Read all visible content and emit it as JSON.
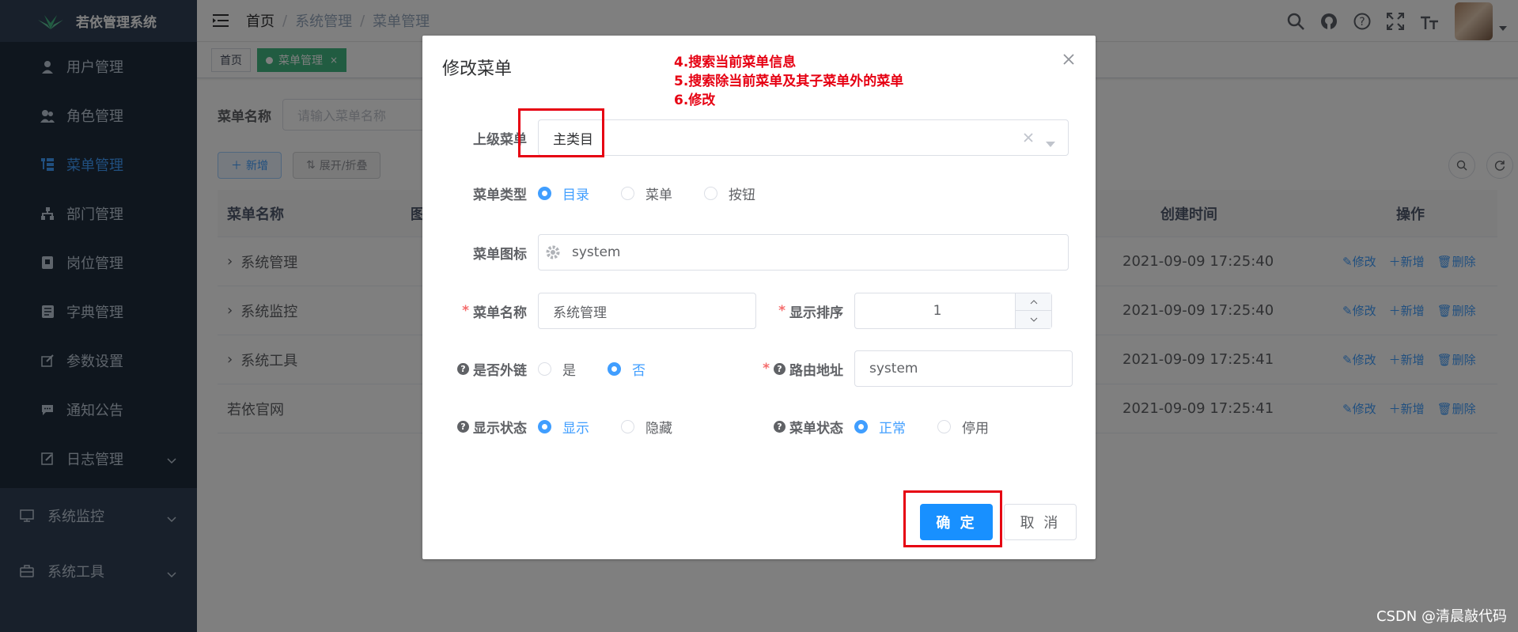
{
  "app": {
    "title": "若依管理系统"
  },
  "sidebar": {
    "items": [
      {
        "label": "用户管理",
        "icon": "user-icon"
      },
      {
        "label": "角色管理",
        "icon": "peoples-icon"
      },
      {
        "label": "菜单管理",
        "icon": "tree-table-icon",
        "active": true
      },
      {
        "label": "部门管理",
        "icon": "tree-icon"
      },
      {
        "label": "岗位管理",
        "icon": "post-icon"
      },
      {
        "label": "字典管理",
        "icon": "dict-icon"
      },
      {
        "label": "参数设置",
        "icon": "edit-icon"
      },
      {
        "label": "通知公告",
        "icon": "message-icon"
      },
      {
        "label": "日志管理",
        "icon": "log-icon"
      }
    ],
    "top_items": [
      {
        "label": "系统监控",
        "icon": "monitor-icon"
      },
      {
        "label": "系统工具",
        "icon": "tool-icon"
      }
    ]
  },
  "breadcrumb": {
    "home": "首页",
    "section": "系统管理",
    "current": "菜单管理",
    "separator": "/"
  },
  "tags": {
    "home": "首页",
    "active": "菜单管理",
    "close": "×"
  },
  "search": {
    "label": "菜单名称",
    "placeholder": "请输入菜单名称"
  },
  "toolbar": {
    "add": "新增",
    "expand": "展开/折叠"
  },
  "table": {
    "headers": {
      "name": "菜单名称",
      "icon": "图",
      "created": "创建时间",
      "ops": "操作"
    },
    "rows": [
      {
        "name": "系统管理",
        "created": "2021-09-09 17:25:40"
      },
      {
        "name": "系统监控",
        "created": "2021-09-09 17:25:40"
      },
      {
        "name": "系统工具",
        "created": "2021-09-09 17:25:41"
      },
      {
        "name": "若依官网",
        "created": "2021-09-09 17:25:41"
      }
    ],
    "ops": {
      "edit": "修改",
      "add": "新增",
      "delete": "删除"
    }
  },
  "dialog": {
    "title": "修改菜单",
    "notes": [
      "4.搜索当前菜单信息",
      "5.搜索除当前菜单及其子菜单外的菜单",
      "6.修改"
    ],
    "parent": {
      "label": "上级菜单",
      "value": "主类目"
    },
    "type": {
      "label": "菜单类型",
      "options": [
        "目录",
        "菜单",
        "按钮"
      ],
      "selected": 0
    },
    "icon": {
      "label": "菜单图标",
      "value": "system"
    },
    "name": {
      "label": "菜单名称",
      "value": "系统管理"
    },
    "order": {
      "label": "显示排序",
      "value": "1"
    },
    "external": {
      "label": "是否外链",
      "options": [
        "是",
        "否"
      ],
      "selected": 1
    },
    "path": {
      "label": "路由地址",
      "value": "system"
    },
    "visible": {
      "label": "显示状态",
      "options": [
        "显示",
        "隐藏"
      ],
      "selected": 0
    },
    "status": {
      "label": "菜单状态",
      "options": [
        "正常",
        "停用"
      ],
      "selected": 0
    },
    "confirm": "确 定",
    "cancel": "取 消"
  },
  "watermark": "CSDN @清晨敲代码",
  "colors": {
    "primary": "#1890ff",
    "sidebar": "#304156",
    "annotation": "#e60012",
    "tag_active": "#42b983"
  }
}
